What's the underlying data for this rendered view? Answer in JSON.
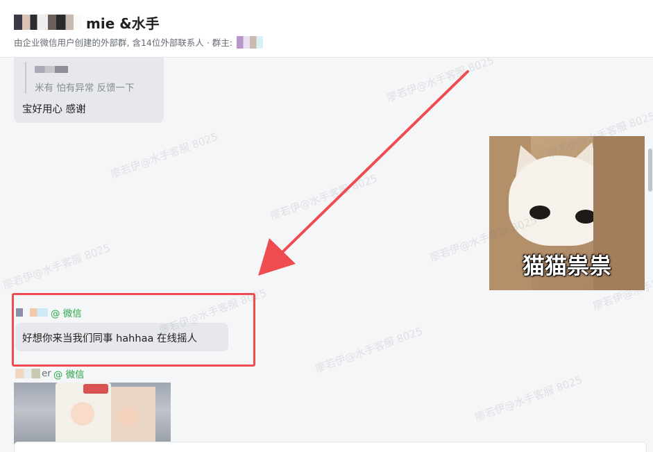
{
  "header": {
    "title_suffix": "mie  &水手",
    "subtitle": "由企业微信用户创建的外部群, 含14位外部联系人 · 群主:"
  },
  "messages": {
    "quote_text": "米有 怕有异常 反馈一下",
    "reply_text": "宝好用心 感谢",
    "sticker_caption": "猫猫祟祟",
    "highlight_sender_tag": "@ 微信",
    "highlight_message": "好想你来当我们同事 hahhaa  在线摇人",
    "second_sender_partial": "er",
    "second_sender_tag": "@ 微信"
  },
  "watermark": {
    "text": "廖若伊@水手客服 8025"
  },
  "colors": {
    "highlight_border": "#ee4c50",
    "arrow": "#ee4c50",
    "wechat_tag": "#28a745"
  }
}
